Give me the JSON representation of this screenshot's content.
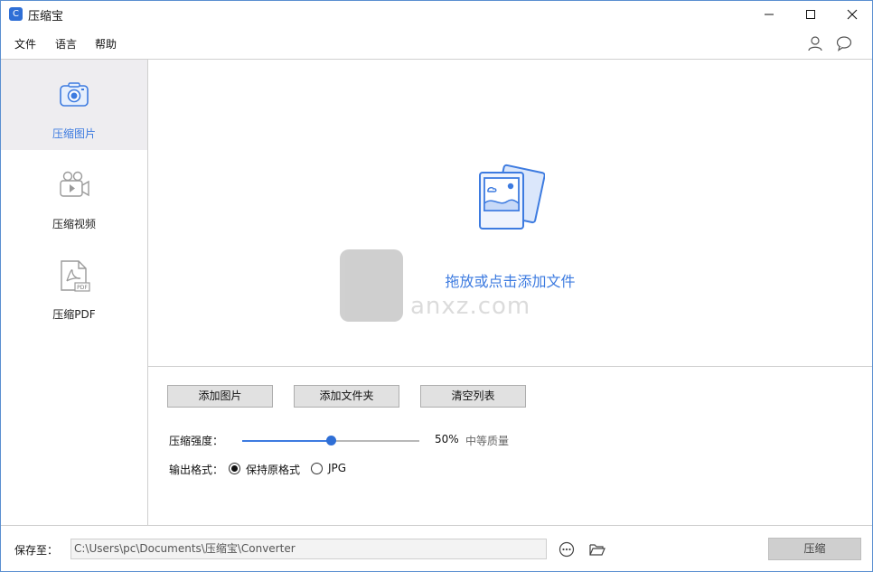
{
  "app": {
    "title": "压缩宝",
    "icon_letter": "C"
  },
  "window_controls": [
    "minimize-icon",
    "maximize-icon",
    "close-icon"
  ],
  "menu": [
    "文件",
    "语言",
    "帮助"
  ],
  "top_icons": [
    "user-icon",
    "chat-icon"
  ],
  "sidebar": {
    "items": [
      {
        "label": "压缩图片",
        "icon": "image-compress-icon",
        "active": true
      },
      {
        "label": "压缩视频",
        "icon": "video-compress-icon",
        "active": false
      },
      {
        "label": "压缩PDF",
        "icon": "pdf-compress-icon",
        "active": false
      }
    ]
  },
  "dropzone": {
    "text": "拖放或点击添加文件",
    "watermark": "anxz.com"
  },
  "controls": {
    "buttons": [
      "添加图片",
      "添加文件夹",
      "清空列表"
    ],
    "strength_label": "压缩强度：",
    "strength_value": "50%",
    "strength_fraction": 0.5,
    "quality_text": "中等质量",
    "format_label": "输出格式：",
    "format_options": [
      {
        "label": "保持原格式",
        "checked": true
      },
      {
        "label": "JPG",
        "checked": false
      }
    ]
  },
  "bottom": {
    "save_label": "保存至：",
    "save_path": "C:\\Users\\pc\\Documents\\压缩宝\\Converter",
    "compress_label": "压缩"
  },
  "colors": {
    "accent": "#3d7be0",
    "border": "#5a8fd0",
    "sidebar_active_bg": "#eeedf0"
  }
}
